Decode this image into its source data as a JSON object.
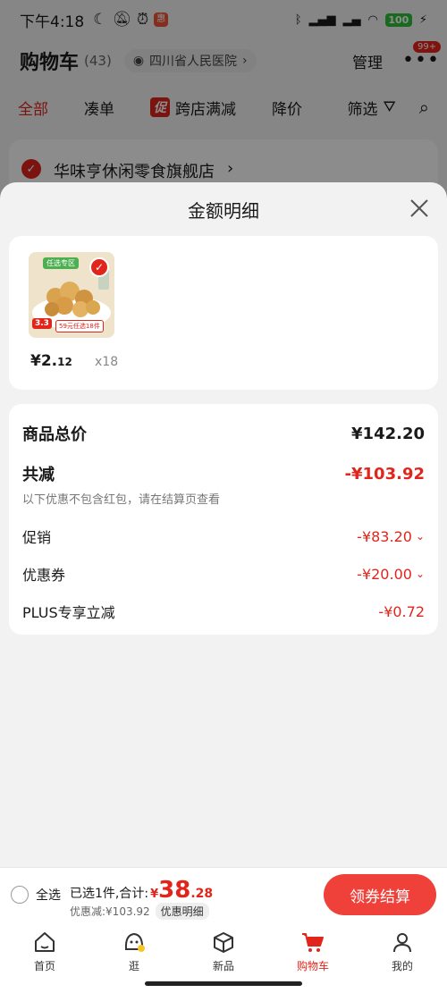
{
  "status_bar": {
    "time": "下午4:18",
    "battery": "100"
  },
  "header": {
    "title": "购物车",
    "count": "(43)",
    "location": "四川省人民医院",
    "manage": "管理",
    "more_badge": "99+"
  },
  "tabs": {
    "all": "全部",
    "bundle": "凑单",
    "promo_tag": "促",
    "cross_store": "跨店满减",
    "price_drop": "降价",
    "filter": "筛选"
  },
  "store": {
    "name": "华味亨休闲零食旗舰店"
  },
  "sheet": {
    "title": "金额明细",
    "product": {
      "thumb_label": "任选专区",
      "thumb_price": "3.3",
      "thumb_promo": "59元任选18件",
      "price_yen": "¥2.",
      "price_dec": "12",
      "qty": "x18"
    },
    "summary": {
      "total_label": "商品总价",
      "total_value": "¥142.20",
      "reduce_label": "共减",
      "reduce_value": "-¥103.92",
      "note": "以下优惠不包含红包，请在结算页查看",
      "promo_label": "促销",
      "promo_value": "-¥83.20",
      "coupon_label": "优惠券",
      "coupon_value": "-¥20.00",
      "plus_label": "PLUS专享立减",
      "plus_value": "-¥0.72"
    }
  },
  "checkout": {
    "select_all": "全选",
    "selected_text": "已选1件,合计:",
    "sum_yen": "¥",
    "sum_int": "38",
    "sum_dec": ".28",
    "discount": "优惠减:¥103.92",
    "detail_chip": "优惠明细",
    "button": "领券结算"
  },
  "tabbar": {
    "home": "首页",
    "browse": "逛",
    "new": "新品",
    "cart": "购物车",
    "mine": "我的"
  },
  "colors": {
    "accent": "#e1251b",
    "button": "#f0403a"
  }
}
